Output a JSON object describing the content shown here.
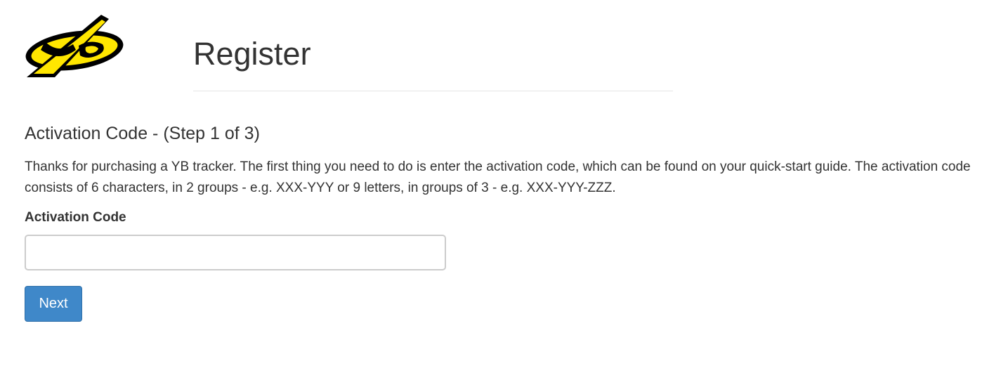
{
  "logo": {
    "icon": "yb-logo"
  },
  "page": {
    "title": "Register"
  },
  "step": {
    "heading": "Activation Code - (Step 1 of 3)",
    "description": "Thanks for purchasing a YB tracker. The first thing you need to do is enter the activation code, which can be found on your quick-start guide. The activation code consists of 6 characters, in 2 groups - e.g. XXX-YYY or 9 letters, in groups of 3 - e.g. XXX-YYY-ZZZ."
  },
  "form": {
    "activation_label": "Activation Code",
    "activation_value": "",
    "next_label": "Next"
  },
  "colors": {
    "accent": "#3f88c9",
    "logo_yellow": "#ffe600",
    "logo_black": "#000000"
  }
}
